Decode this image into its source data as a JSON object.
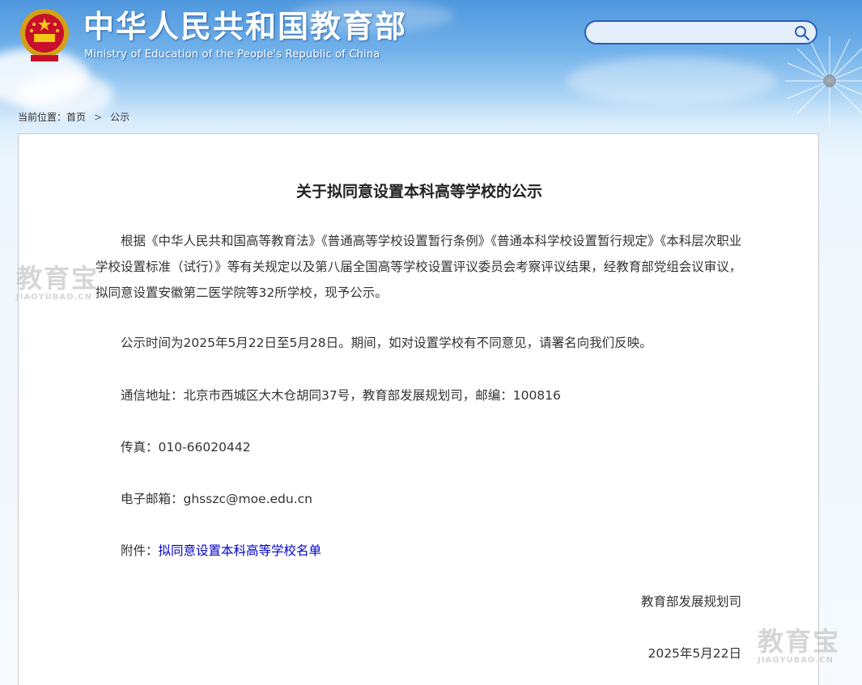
{
  "header": {
    "title": "中华人民共和国教育部",
    "subtitle": "Ministry of Education of the People's Republic of China",
    "emblem_icon": "national-emblem-icon"
  },
  "search": {
    "placeholder": "",
    "icon": "search-icon"
  },
  "breadcrumb": {
    "label": "当前位置：",
    "home": "首页",
    "separator": ">",
    "current": "公示"
  },
  "article": {
    "title": "关于拟同意设置本科高等学校的公示",
    "paragraph_1": "根据《中华人民共和国高等教育法》《普通高等学校设置暂行条例》《普通本科学校设置暂行规定》《本科层次职业学校设置标准（试行）》等有关规定以及第八届全国高等学校设置评议委员会考察评议结果，经教育部党组会议审议，拟同意设置安徽第二医学院等32所学校，现予公示。",
    "paragraph_2": "公示时间为2025年5月22日至5月28日。期间，如对设置学校有不同意见，请署名向我们反映。",
    "address": "通信地址：北京市西城区大木仓胡同37号，教育部发展规划司，邮编：100816",
    "fax": "传真：010-66020442",
    "email": "电子邮箱：ghsszc@moe.edu.cn",
    "attachment_label": "附件：",
    "attachment_link": "拟同意设置本科高等学校名单",
    "signature_org": "教育部发展规划司",
    "signature_date": "2025年5月22日"
  },
  "watermark": {
    "text": "教育宝",
    "url": "JIAOYUBAO.CN"
  },
  "colors": {
    "sky_top": "#4f97dd",
    "link": "#0000cc",
    "search_border": "#2b5fb4"
  }
}
